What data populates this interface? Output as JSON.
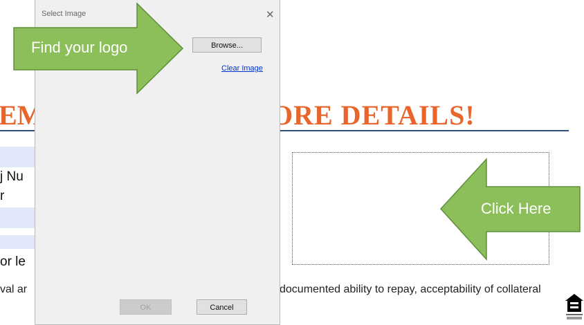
{
  "page": {
    "headline_left": "EM",
    "headline_right": "ORE DETAILS!",
    "rows": [
      "j Nu",
      "r",
      "",
      "",
      "or le"
    ],
    "disclaimer_left": "val ar",
    "disclaimer_right": "documented ability to repay, acceptability of collateral"
  },
  "dialog": {
    "title": "Select Image",
    "close_glyph": "✕",
    "browse_label": "Browse...",
    "clear_label": "Clear Image",
    "ok_label": "OK",
    "cancel_label": "Cancel"
  },
  "annotations": {
    "find_logo": "Find your logo",
    "click_here": "Click Here",
    "arrow_color": "#8cbe59"
  },
  "colors": {
    "headline": "#e8652c",
    "rule": "#2e4d7f",
    "row_band": "#dfe7f8"
  }
}
